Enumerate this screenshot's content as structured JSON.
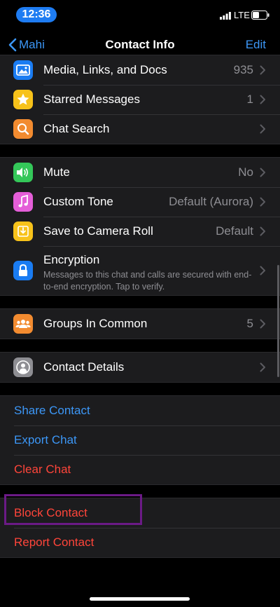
{
  "status_bar": {
    "time": "12:36",
    "network": "LTE",
    "time_pill_color": "#1e7cf2"
  },
  "nav": {
    "back_label": "Mahi",
    "title": "Contact Info",
    "edit_label": "Edit"
  },
  "media_group": [
    {
      "label": "Media, Links, and Docs",
      "value": "935",
      "icon": "photo-icon",
      "icon_color": "#1a7cf2"
    },
    {
      "label": "Starred Messages",
      "value": "1",
      "icon": "star-icon",
      "icon_color": "#f7c21a"
    },
    {
      "label": "Chat Search",
      "value": "",
      "icon": "search-icon",
      "icon_color": "#f28b30"
    }
  ],
  "settings_group": [
    {
      "label": "Mute",
      "value": "No",
      "icon": "speaker-icon",
      "icon_color": "#34c759"
    },
    {
      "label": "Custom Tone",
      "value": "Default (Aurora)",
      "icon": "music-note-icon",
      "icon_color": "#e45ed8"
    },
    {
      "label": "Save to Camera Roll",
      "value": "Default",
      "icon": "download-icon",
      "icon_color": "#f7c21a"
    }
  ],
  "encryption": {
    "label": "Encryption",
    "description": "Messages to this chat and calls are secured with end-to-end encryption. Tap to verify.",
    "icon": "lock-icon",
    "icon_color": "#1a7cf2"
  },
  "groups_in_common": {
    "label": "Groups In Common",
    "value": "5",
    "icon": "group-icon",
    "icon_color": "#f28b30"
  },
  "contact_details": {
    "label": "Contact Details",
    "icon": "person-icon",
    "icon_color": "#8e8e93"
  },
  "actions_group": [
    {
      "label": "Share Contact",
      "color": "#3c97f7"
    },
    {
      "label": "Export Chat",
      "color": "#3c97f7"
    },
    {
      "label": "Clear Chat",
      "color": "#ff453a"
    }
  ],
  "danger_group": [
    {
      "label": "Block Contact",
      "color": "#ff453a"
    },
    {
      "label": "Report Contact",
      "color": "#ff453a"
    }
  ],
  "highlight_color": "#6b1a86"
}
